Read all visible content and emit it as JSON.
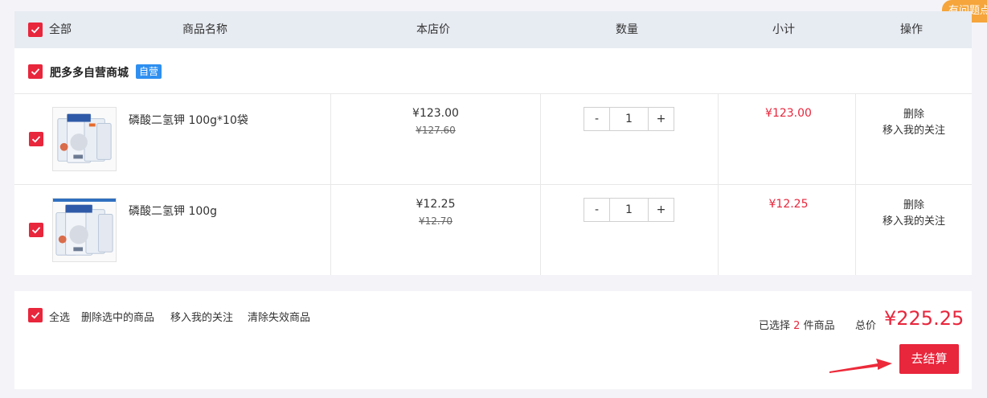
{
  "help_tab": "有问题点",
  "header": {
    "select_all": "全部",
    "product_name": "商品名称",
    "price": "本店价",
    "quantity": "数量",
    "subtotal": "小计",
    "actions": "操作"
  },
  "shop": {
    "name": "肥多多自营商城",
    "badge": "自营"
  },
  "items": [
    {
      "name": "磷酸二氢钾 100g*10袋",
      "price": "¥123.00",
      "original_price": "¥127.60",
      "quantity": "1",
      "subtotal": "¥123.00",
      "delete": "删除",
      "follow": "移入我的关注"
    },
    {
      "name": "磷酸二氢钾 100g",
      "price": "¥12.25",
      "original_price": "¥12.70",
      "quantity": "1",
      "subtotal": "¥12.25",
      "delete": "删除",
      "follow": "移入我的关注"
    }
  ],
  "qty_controls": {
    "minus": "-",
    "plus": "+"
  },
  "footer": {
    "select_all": "全选",
    "delete_selected": "删除选中的商品",
    "move_to_follow": "移入我的关注",
    "clear_invalid": "清除失效商品",
    "selected_prefix": "已选择",
    "selected_count": "2",
    "selected_suffix": "件商品",
    "total_label": "总价",
    "total_value": "¥225.25",
    "checkout": "去结算"
  },
  "colors": {
    "accent": "#e8263c",
    "header_bg": "#e7ebf2",
    "badge": "#2e8ff0",
    "help_tab": "#f5a53b"
  }
}
